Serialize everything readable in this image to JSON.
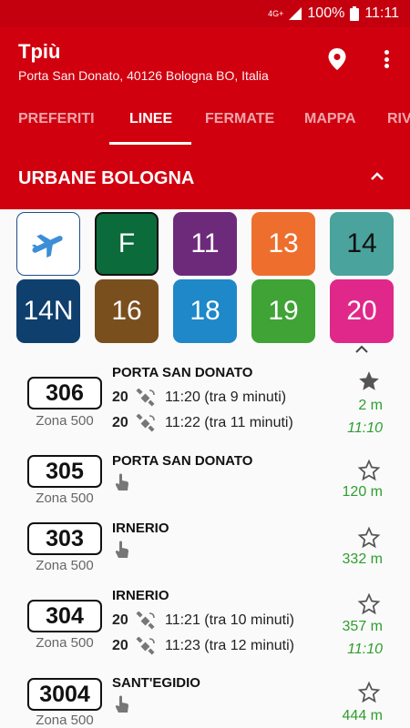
{
  "status_bar": {
    "network": "4G+",
    "battery": "100%",
    "time": "11:11"
  },
  "app": {
    "title": "Tpiù",
    "subtitle": "Porta San Donato, 40126 Bologna BO, Italia"
  },
  "tabs": [
    {
      "label": "PREFERITI",
      "active": false
    },
    {
      "label": "LINEE",
      "active": true
    },
    {
      "label": "FERMATE",
      "active": false
    },
    {
      "label": "MAPPA",
      "active": false
    },
    {
      "label": "RIV",
      "active": false
    }
  ],
  "section": {
    "title": "URBANE BOLOGNA"
  },
  "line_tiles": [
    {
      "label": "",
      "icon": "airplane-icon",
      "color": "#ffffff"
    },
    {
      "label": "F",
      "color": "#0b6b3a"
    },
    {
      "label": "11",
      "color": "#6e2a7a"
    },
    {
      "label": "13",
      "color": "#ee6f2d"
    },
    {
      "label": "14",
      "color": "#4aa39c"
    },
    {
      "label": "14N",
      "color": "#0f3f6d"
    },
    {
      "label": "16",
      "color": "#7a4f1e"
    },
    {
      "label": "18",
      "color": "#1e88c8"
    },
    {
      "label": "19",
      "color": "#3fa336"
    },
    {
      "label": "20",
      "color": "#e0288a"
    }
  ],
  "stops": [
    {
      "code": "306",
      "zone": "Zona 500",
      "destination": "PORTA SAN DONATO",
      "departures": [
        {
          "line": "20",
          "text": "11:20 (tra 9 minuti)"
        },
        {
          "line": "20",
          "text": "11:22 (tra 11 minuti)"
        }
      ],
      "distance": "2 m",
      "time": "11:10",
      "favorite": true
    },
    {
      "code": "305",
      "zone": "Zona 500",
      "destination": "PORTA SAN DONATO",
      "departures": [],
      "distance": "120 m",
      "time": "",
      "favorite": false
    },
    {
      "code": "303",
      "zone": "Zona 500",
      "destination": "IRNERIO",
      "departures": [],
      "distance": "332 m",
      "time": "",
      "favorite": false
    },
    {
      "code": "304",
      "zone": "Zona 500",
      "destination": "IRNERIO",
      "departures": [
        {
          "line": "20",
          "text": "11:21 (tra 10 minuti)"
        },
        {
          "line": "20",
          "text": "11:23 (tra 12 minuti)"
        }
      ],
      "distance": "357 m",
      "time": "11:10",
      "favorite": false
    },
    {
      "code": "3004",
      "zone": "Zona 500",
      "destination": "SANT'EGIDIO",
      "departures": [],
      "distance": "444 m",
      "time": "",
      "favorite": false
    }
  ],
  "colors": {
    "appbar": "#d0000f",
    "accent_green": "#2e9e2e"
  }
}
